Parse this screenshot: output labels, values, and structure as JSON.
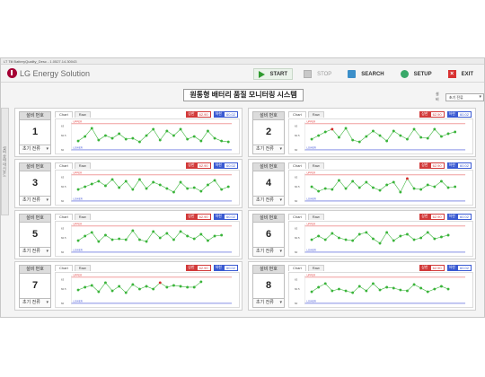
{
  "window_title": "LT Till BatteryQuality_Desc - 1.0527.14.30043",
  "header": {
    "logo_text": "LG Energy Solution",
    "toolbar": {
      "start": "START",
      "stop": "STOP",
      "search": "SEARCH",
      "setup": "SETUP",
      "exit": "EXIT"
    }
  },
  "page_title": "원통형 배터리 품질 모니터링 시스템",
  "side_tab": "설비 상태 대시보드",
  "selector": {
    "label": "설비",
    "value": "초기 전류"
  },
  "panels": [
    {
      "header": "설비 번호",
      "number": "1",
      "select": "초기 전류",
      "tabs": [
        "Chart",
        "Raw"
      ],
      "upper_label": "상한",
      "upper_value": "62.90",
      "lower_label": "하한",
      "lower_value": "60.02",
      "y_ticks": [
        "63",
        "60.5",
        "60"
      ],
      "upper_line_label": "UPPER",
      "lower_line_label": "LOWER",
      "values": [
        61.0,
        61.5,
        62.4,
        61.1,
        61.6,
        61.3,
        61.8,
        61.2,
        61.3,
        60.9,
        61.6,
        62.3,
        61.1,
        62.1,
        61.6,
        62.3,
        61.2,
        61.5,
        61.0,
        62.1,
        61.3,
        61.0,
        60.9
      ],
      "highlight_index": -1
    },
    {
      "header": "설비 번호",
      "number": "2",
      "select": "초기 전류",
      "tabs": [
        "Chart",
        "Raw"
      ],
      "upper_label": "상한",
      "upper_value": "62.90",
      "lower_label": "하한",
      "lower_value": "60.02",
      "y_ticks": [
        "63",
        "60.5",
        "60"
      ],
      "upper_line_label": "UPPER",
      "lower_line_label": "LOWER",
      "values": [
        61.2,
        61.6,
        62.0,
        62.3,
        61.4,
        62.4,
        61.1,
        60.9,
        61.5,
        62.1,
        61.6,
        61.0,
        62.1,
        61.6,
        61.2,
        62.3,
        61.4,
        61.3,
        62.3,
        61.5,
        61.8,
        62.0
      ],
      "highlight_index": 3
    },
    {
      "header": "설비 번호",
      "number": "3",
      "select": "초기 전류",
      "tabs": [
        "Chart",
        "Raw"
      ],
      "upper_label": "상한",
      "upper_value": "62.90",
      "lower_label": "하한",
      "lower_value": "60.02",
      "y_ticks": [
        "63",
        "60.5",
        "60"
      ],
      "upper_line_label": "UPPER",
      "lower_line_label": "LOWER",
      "values": [
        61.3,
        61.6,
        61.9,
        62.2,
        61.7,
        62.4,
        61.5,
        62.2,
        61.3,
        62.4,
        61.4,
        62.1,
        61.8,
        61.4,
        61.0,
        62.1,
        61.4,
        61.5,
        61.1,
        61.8,
        62.3,
        61.3,
        61.6
      ],
      "highlight_index": -1
    },
    {
      "header": "설비 번호",
      "number": "4",
      "select": "초기 전류",
      "tabs": [
        "Chart",
        "Raw"
      ],
      "upper_label": "상한",
      "upper_value": "62.90",
      "lower_label": "하한",
      "lower_value": "60.02",
      "y_ticks": [
        "63",
        "60.5",
        "60"
      ],
      "upper_line_label": "UPPER",
      "lower_line_label": "LOWER",
      "values": [
        61.6,
        61.1,
        61.4,
        61.3,
        62.3,
        61.4,
        62.2,
        61.5,
        62.1,
        61.5,
        61.2,
        61.8,
        62.1,
        61.0,
        62.5,
        61.4,
        61.3,
        61.8,
        61.6,
        62.2,
        61.5,
        61.6
      ],
      "highlight_index": 14
    },
    {
      "header": "설비 번호",
      "number": "5",
      "select": "초기 전류",
      "tabs": [
        "Chart",
        "Raw"
      ],
      "upper_label": "상한",
      "upper_value": "62.90",
      "lower_label": "하한",
      "lower_value": "60.02",
      "y_ticks": [
        "63",
        "60.5",
        "60"
      ],
      "upper_line_label": "UPPER",
      "lower_line_label": "LOWER",
      "values": [
        61.3,
        61.8,
        62.2,
        61.2,
        61.9,
        61.4,
        61.5,
        61.4,
        62.4,
        61.4,
        61.2,
        62.3,
        61.6,
        62.1,
        61.4,
        62.3,
        61.8,
        61.5,
        62.0,
        61.3,
        61.8,
        61.9
      ],
      "highlight_index": -1
    },
    {
      "header": "설비 번호",
      "number": "6",
      "select": "초기 전류",
      "tabs": [
        "Chart",
        "Raw"
      ],
      "upper_label": "상한",
      "upper_value": "62.90",
      "lower_label": "하한",
      "lower_value": "60.02",
      "y_ticks": [
        "63",
        "60.5",
        "60"
      ],
      "upper_line_label": "UPPER",
      "lower_line_label": "LOWER",
      "values": [
        61.4,
        61.8,
        61.4,
        62.1,
        61.6,
        61.4,
        61.3,
        62.0,
        62.2,
        61.5,
        61.0,
        62.2,
        61.3,
        61.8,
        62.0,
        61.4,
        61.6,
        62.2,
        61.5,
        61.7,
        61.9
      ],
      "highlight_index": -1
    },
    {
      "header": "설비 번호",
      "number": "7",
      "select": "초기 전류",
      "tabs": [
        "Chart",
        "Raw"
      ],
      "upper_label": "상한",
      "upper_value": "62.90",
      "lower_label": "하한",
      "lower_value": "60.02",
      "y_ticks": [
        "63",
        "60.5",
        "60"
      ],
      "upper_line_label": "UPPER",
      "lower_line_label": "LOWER",
      "values": [
        61.5,
        61.8,
        62.0,
        61.3,
        62.3,
        61.4,
        61.9,
        61.2,
        62.1,
        61.6,
        61.9,
        61.6,
        62.3,
        61.8,
        62.0,
        61.9,
        61.8,
        61.8,
        62.4
      ],
      "highlight_index": 12
    },
    {
      "header": "설비 번호",
      "number": "8",
      "select": "초기 전류",
      "tabs": [
        "Chart",
        "Raw"
      ],
      "upper_label": "상한",
      "upper_value": "62.90",
      "lower_label": "하한",
      "lower_value": "60.02",
      "y_ticks": [
        "63",
        "60.5",
        "60"
      ],
      "upper_line_label": "UPPER",
      "lower_line_label": "LOWER",
      "values": [
        61.3,
        61.8,
        62.2,
        61.4,
        61.6,
        61.4,
        61.2,
        61.9,
        61.4,
        62.2,
        61.5,
        61.8,
        61.7,
        61.5,
        61.4,
        62.1,
        61.7,
        61.3,
        61.6,
        61.9,
        61.6
      ],
      "highlight_index": -1
    }
  ],
  "chart_data": {
    "type": "scatter",
    "ylim": [
      59.9,
      63.1
    ],
    "upper_limit": 62.9,
    "lower_limit": 60.02,
    "point_color": "#3ab43a",
    "line_color": "#3ab43a",
    "highlight_color": "#d42a2a",
    "upper_line_color": "#e23c3c",
    "lower_line_color": "#3b4ed6"
  }
}
